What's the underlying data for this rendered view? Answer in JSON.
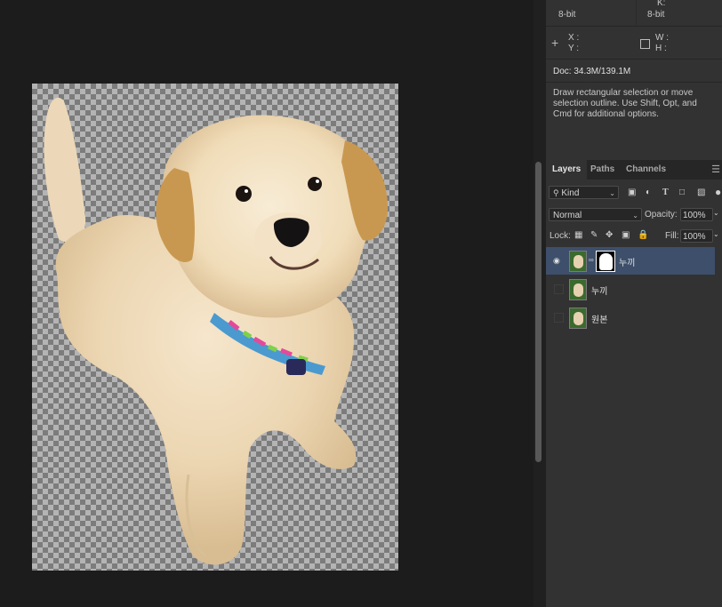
{
  "info": {
    "k_label": "K:",
    "left_depth": "8-bit",
    "right_depth": "8-bit",
    "x_label": "X :",
    "y_label": "Y :",
    "w_label": "W :",
    "h_label": "H :",
    "doc": "Doc: 34.3M/139.1M",
    "hint_line1": "Draw rectangular selection or move",
    "hint_line2": "selection outline.  Use Shift, Opt, and",
    "hint_line3": "Cmd for additional options."
  },
  "layers_panel": {
    "tabs": [
      {
        "label": "Layers",
        "active": true
      },
      {
        "label": "Paths",
        "active": false
      },
      {
        "label": "Channels",
        "active": false
      }
    ],
    "filter": "Kind",
    "blend_mode": "Normal",
    "opacity_label": "Opacity:",
    "opacity_value": "100%",
    "lock_label": "Lock:",
    "fill_label": "Fill:",
    "fill_value": "100%",
    "layers": [
      {
        "name": "누끼",
        "visible": true,
        "selected": true,
        "has_mask": true
      },
      {
        "name": "누끼",
        "visible": false,
        "selected": false,
        "has_mask": false
      },
      {
        "name": "원본",
        "visible": false,
        "selected": false,
        "has_mask": false
      }
    ]
  },
  "icons": {
    "crosshair": "crosshair-icon",
    "selection_box": "selection-box-icon",
    "menu": "panel-menu-icon",
    "search": "search-icon",
    "eye": "eye-icon",
    "link": "chain-link-icon"
  },
  "colors": {
    "panel_bg": "#323232",
    "selected_layer": "#3d4f6b",
    "workspace_bg": "#1c1c1c"
  }
}
